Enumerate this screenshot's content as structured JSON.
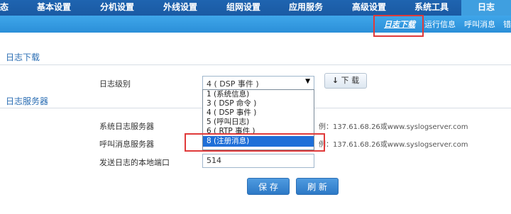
{
  "topnav": {
    "tabs": [
      "态",
      "基本设置",
      "分机设置",
      "外线设置",
      "组网设置",
      "应用服务",
      "高级设置",
      "系统工具",
      "日志"
    ]
  },
  "subnav": {
    "items": [
      "日志下载",
      "运行信息",
      "呼叫消息",
      "错"
    ]
  },
  "sections": {
    "download_title": "日志下载",
    "server_title": "日志服务器"
  },
  "download": {
    "level_label": "日志级别",
    "level_value": "4 ( DSP 事件 )",
    "download_button": "下 载",
    "options": [
      "1 (系统信息)",
      "3 ( DSP 命令 )",
      "4 ( DSP 事件 )",
      "5 (呼叫日志)",
      "6 ( RTP 事件 )",
      "8 (注册消息)"
    ]
  },
  "server": {
    "syslog_label": "系统日志服务器",
    "syslog_hint": "例：137.61.68.26或www.syslogserver.com",
    "call_label": "呼叫消息服务器",
    "call_hint": "例：137.61.68.26或www.syslogserver.com",
    "port_label": "发送日志的本地端口",
    "port_value": "514"
  },
  "buttons": {
    "save": "保 存",
    "refresh": "刷 新"
  }
}
